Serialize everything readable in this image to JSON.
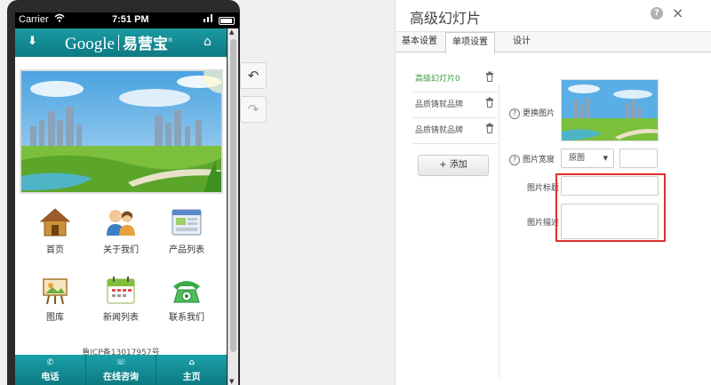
{
  "status_bar": {
    "carrier": "Carrier",
    "wifi_icon": "wifi-icon",
    "time": "7:51 PM",
    "signal": "ıl"
  },
  "app_header": {
    "logo_google": "Google",
    "logo_cn": "易营宝",
    "logo_mark": "®",
    "down_icon": "⬇",
    "home_icon": "⌂"
  },
  "grid": [
    {
      "label": "首页",
      "icon": "house-icon"
    },
    {
      "label": "关于我们",
      "icon": "people-icon"
    },
    {
      "label": "产品列表",
      "icon": "window-icon"
    },
    {
      "label": "图库",
      "icon": "easel-icon"
    },
    {
      "label": "新闻列表",
      "icon": "calendar-icon"
    },
    {
      "label": "联系我们",
      "icon": "telephone-icon"
    }
  ],
  "icp": "鲁ICP备13017957号",
  "bottom_nav": [
    {
      "label": "电话",
      "icon": "phone-icon",
      "glyph": "✆"
    },
    {
      "label": "在线咨询",
      "icon": "chat-icon",
      "glyph": "☏"
    },
    {
      "label": "主页",
      "icon": "home-icon",
      "glyph": "⌂"
    }
  ],
  "toolbar": {
    "undo": "↶",
    "redo": "↷"
  },
  "panel": {
    "title": "高级幻灯片",
    "help": "?",
    "close": "×",
    "tabs": [
      "基本设置",
      "单项设置",
      "设计"
    ],
    "active_tab": "单项设置",
    "slides": [
      {
        "label": "高级幻灯片0",
        "active": true
      },
      {
        "label": "品质铸就品牌",
        "active": false
      },
      {
        "label": "品质铸就品牌",
        "active": false
      }
    ],
    "trash_glyph": "🗑",
    "add_button": "+ 添加",
    "form": {
      "change_image": "更换图片",
      "image_width": "图片宽度",
      "width_option": "原图",
      "image_title": "图片标题",
      "image_desc": "图片描述",
      "q": "?"
    }
  },
  "colors": {
    "accent": "#1b9aa3",
    "highlight": "#e03030",
    "active_slide": "#3a9a3a"
  }
}
